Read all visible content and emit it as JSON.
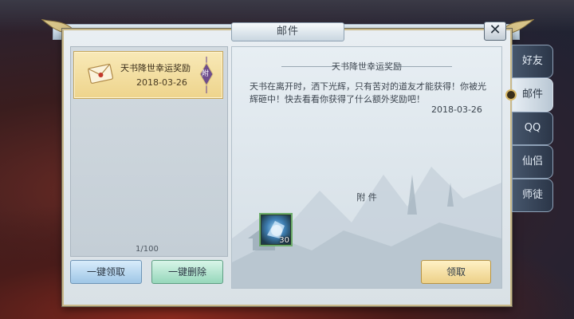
{
  "window": {
    "title": "邮件",
    "close_label": "✕"
  },
  "mail_list": {
    "items": [
      {
        "title": "天书降世幸运奖励",
        "date": "2018-03-26",
        "attachment_tag": "附"
      }
    ],
    "count": "1/100",
    "claim_all_label": "一键领取",
    "delete_all_label": "一键删除"
  },
  "mail_detail": {
    "title": "天书降世幸运奖励",
    "body": "天书在离开时，洒下光辉，只有苦对的道友才能获得！你被光辉砸中！快去看看你获得了什么额外奖励吧！",
    "date": "2018-03-26",
    "attachments_label": "附 件",
    "attachments": [
      {
        "icon": "blue-orb-item-icon",
        "quantity": "30"
      }
    ],
    "claim_label": "领取"
  },
  "side_tabs": [
    {
      "label": "好友",
      "active": false
    },
    {
      "label": "邮件",
      "active": true
    },
    {
      "label": "QQ",
      "active": false
    },
    {
      "label": "仙侣",
      "active": false
    },
    {
      "label": "师徒",
      "active": false
    }
  ],
  "colors": {
    "accent_gold": "#ecd088",
    "panel_bg": "#e3eaf0",
    "active_tab": "#e7eef4"
  }
}
